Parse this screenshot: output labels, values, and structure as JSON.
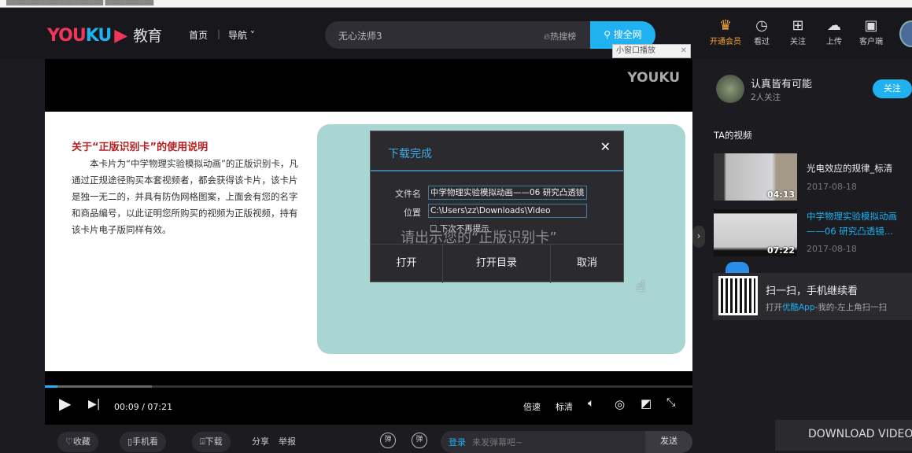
{
  "top_strip": {
    "text": "████████████████████  ██████████"
  },
  "header": {
    "logo": {
      "you": "YOU",
      "ku": "KU",
      "edu": "教育"
    },
    "nav": [
      "首页",
      "导航"
    ],
    "search": {
      "query": "无心法师3",
      "hot": "热搜榜",
      "button": "搜全网"
    },
    "mini_window": "小窗口播放",
    "icons": [
      {
        "label": "开通会员",
        "icon": "crown-icon"
      },
      {
        "label": "看过",
        "icon": "clock-icon"
      },
      {
        "label": "关注",
        "icon": "bookmark-icon"
      },
      {
        "label": "上传",
        "icon": "upload-cloud-icon"
      },
      {
        "label": "客户端",
        "icon": "client-icon"
      }
    ]
  },
  "video": {
    "watermark": "YOUKU",
    "slide_title": "关于“正版识别卡”的使用说明",
    "slide_body": "本卡片为“中学物理实验模拟动画”的正版识别卡，凡通过正规途径购买本套视频者，都会获得该卡片，该卡片是独一无二的，并具有防伪网格图案，上面会有您的名字和商品编号，以此证明您所购买的视频为正版视频，持有该卡片电子版同样有效。",
    "slide_overlay": "请出示您的“正版识别卡”",
    "progress_percent": 2,
    "time_current": "00:09",
    "time_total": "07:21",
    "speed": "倍速",
    "quality": "标清"
  },
  "dialog": {
    "title": "下载完成",
    "filename_label": "文件名",
    "filename": "中学物理实验模拟动画——06 研究凸透镜",
    "location_label": "位置",
    "location": "C:\\Users\\zz\\Downloads\\Video",
    "checkbox": "下次不再提示",
    "buttons": [
      "打开",
      "打开目录",
      "取消"
    ]
  },
  "bottom": {
    "collect": "收藏",
    "phone": "手机看",
    "download": "下载",
    "share": "分享",
    "report": "举报",
    "danmu": "弹",
    "login": "登录",
    "comment_placeholder": "来发弹幕吧~",
    "send": "发送"
  },
  "sidebar": {
    "author": "认真皆有可能",
    "followers": "2人关注",
    "follow": "关注",
    "section": "TA的视频",
    "videos": [
      {
        "title": "光电效应的规律_标清",
        "date": "2017-08-18",
        "duration": "04:13"
      },
      {
        "title": "中学物理实验模拟动画——06 研究凸透镜...",
        "date": "2017-08-18",
        "duration": "07:22"
      }
    ],
    "qr": {
      "title": "扫一扫，手机继续看",
      "pre": "打开",
      "app": "优酷App",
      "post": "-我的-左上角扫一扫"
    }
  },
  "download_video": "DOWNLOAD VIDEO",
  "colors": {
    "accent": "#1fb1f0",
    "brand_red": "#f0365a"
  }
}
